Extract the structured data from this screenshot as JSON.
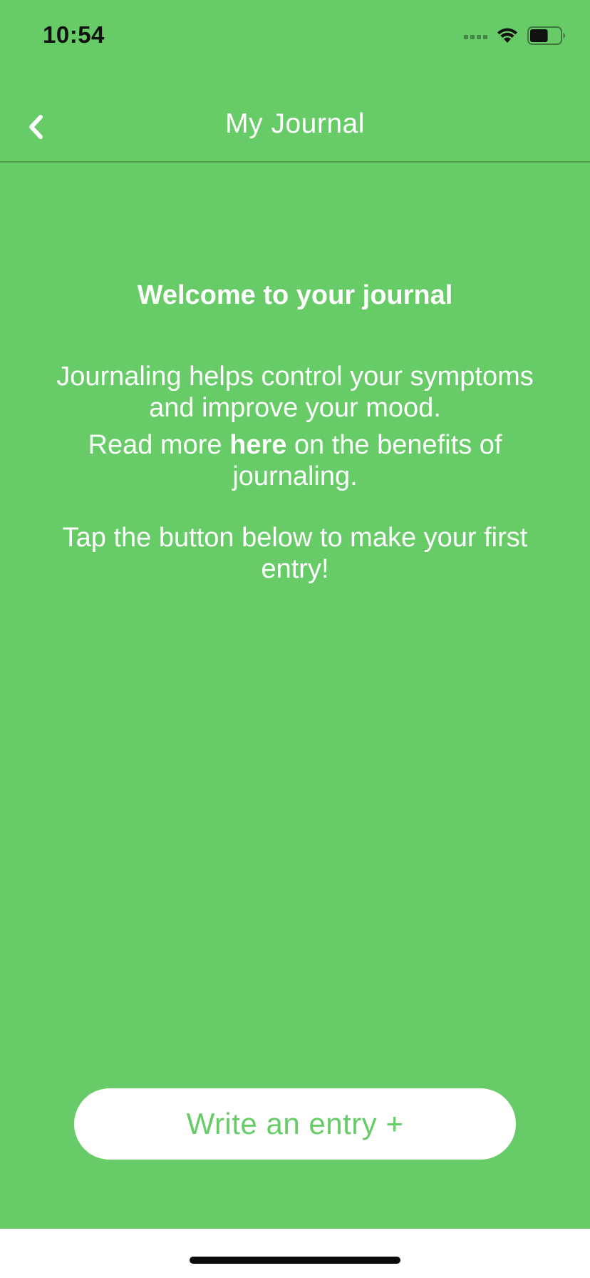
{
  "status_bar": {
    "time": "10:54",
    "signal_icon": "signal-icon",
    "wifi_icon": "wifi-icon",
    "battery_icon": "battery-icon",
    "battery_level": 0.6
  },
  "nav": {
    "back_icon": "chevron-left-icon",
    "title": "My Journal"
  },
  "content": {
    "welcome_title": "Welcome to your journal",
    "para1": "Journaling helps control your symptoms and improve your mood.",
    "para2_prefix": "Read more ",
    "para2_link": "here",
    "para2_suffix": " on the benefits of journaling.",
    "para3": "Tap the button below to make your first entry!"
  },
  "actions": {
    "write_entry_label": "Write an entry +"
  },
  "colors": {
    "background": "#67cc67",
    "text": "#ffffff",
    "button_background": "#ffffff",
    "button_text": "#67cc67"
  }
}
